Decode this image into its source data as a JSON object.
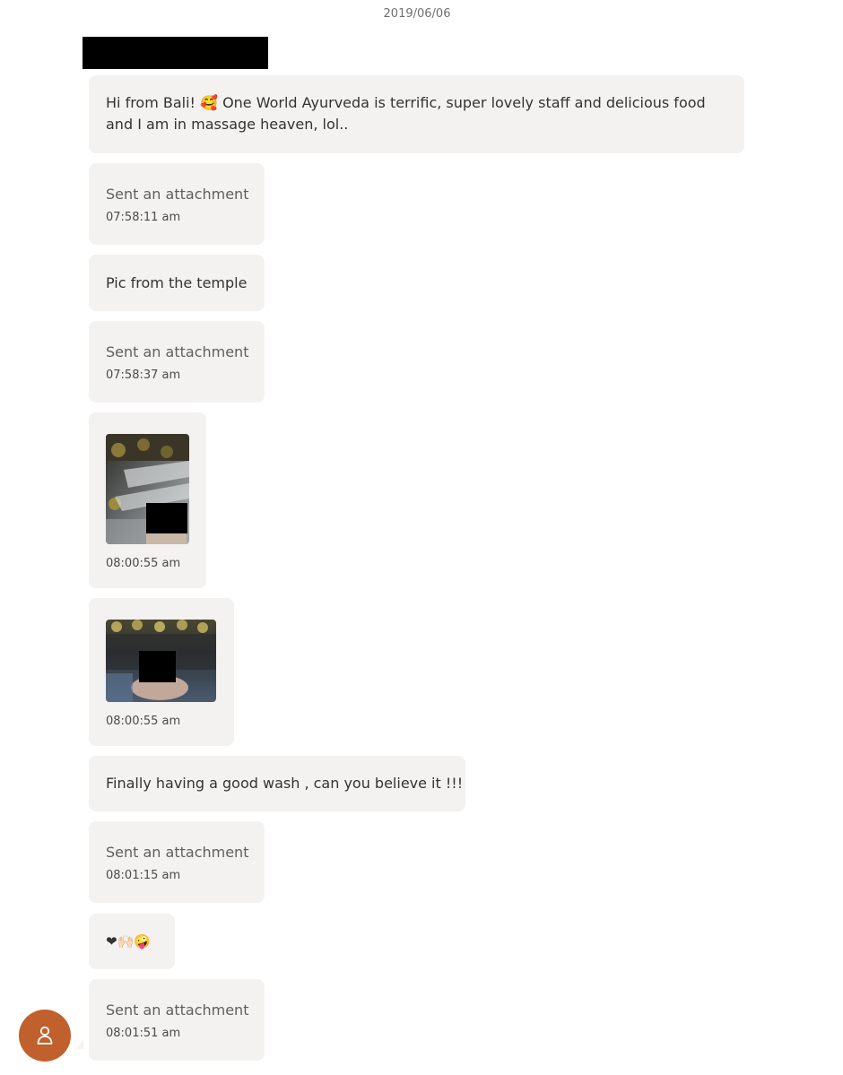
{
  "conversation": {
    "date": "2019/06/06",
    "messages": [
      {
        "type": "text",
        "lines": [
          "Hi from Bali! 🥰 One World Ayurveda is terrific, super lovely staff and delicious food",
          "and I am in massage heaven, lol.."
        ]
      },
      {
        "type": "attachment",
        "label": "Sent an attachment",
        "time": "07:58:11 am"
      },
      {
        "type": "text",
        "lines": [
          "Pic from the temple"
        ]
      },
      {
        "type": "attachment",
        "label": "Sent an attachment",
        "time": "07:58:37 am"
      },
      {
        "type": "image",
        "time": "08:00:55 am"
      },
      {
        "type": "image",
        "time": "08:00:55 am"
      },
      {
        "type": "text",
        "lines": [
          "Finally having a good wash , can you believe it !!!"
        ]
      },
      {
        "type": "attachment",
        "label": "Sent an attachment",
        "time": "08:01:15 am"
      },
      {
        "type": "emoji",
        "text": "❤🙌🏻🤪"
      },
      {
        "type": "attachment",
        "label": "Sent an attachment",
        "time": "08:01:51 am"
      }
    ]
  },
  "icons": {
    "avatar": "user-icon"
  },
  "colors": {
    "bubble": "#f4f2f1",
    "avatar": "#c0602c"
  }
}
